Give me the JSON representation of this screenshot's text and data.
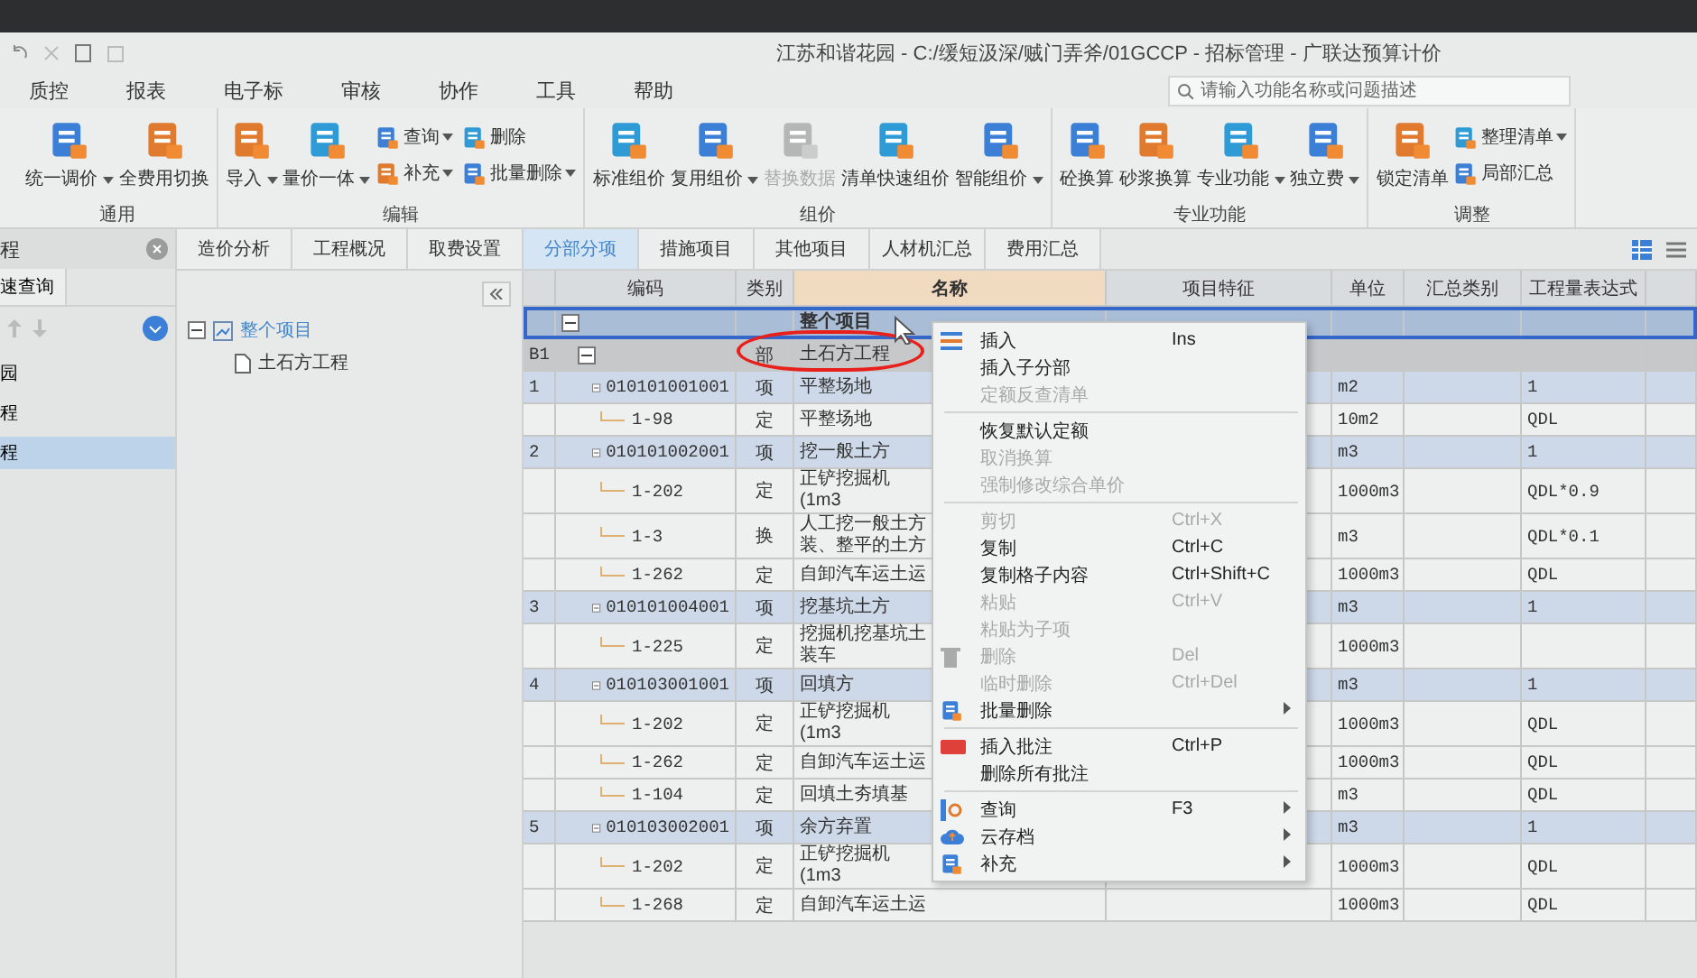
{
  "title_bar": {
    "title": "江苏和谐花园 - C:/缓短汲深/贼门弄斧/01GCCP - 招标管理 - 广联达预算计价"
  },
  "menu_bar": {
    "items": [
      "质控",
      "报表",
      "电子标",
      "审核",
      "协作",
      "工具",
      "帮助"
    ],
    "search": {
      "placeholder": "请输入功能名称或问题描述"
    }
  },
  "ribbon": {
    "groups": [
      {
        "label": "通用",
        "buttons": [
          {
            "label": "统一调价",
            "kind": "large",
            "dropdown": true,
            "disabled": false
          },
          {
            "label": "全费用切换",
            "kind": "large",
            "dropdown": false,
            "disabled": false
          }
        ]
      },
      {
        "label": "编辑",
        "buttons": [
          {
            "label": "导入",
            "kind": "large",
            "dropdown": true,
            "disabled": false
          },
          {
            "label": "量价一体",
            "kind": "large",
            "dropdown": true,
            "disabled": false
          },
          {
            "label": "查询",
            "kind": "small",
            "dropdown": true,
            "disabled": false
          },
          {
            "label": "补充",
            "kind": "small",
            "dropdown": true,
            "disabled": false
          },
          {
            "label": "删除",
            "kind": "small",
            "dropdown": false,
            "disabled": false
          },
          {
            "label": "批量删除",
            "kind": "small",
            "dropdown": true,
            "disabled": false
          }
        ]
      },
      {
        "label": "组价",
        "buttons": [
          {
            "label": "标准组价",
            "kind": "large",
            "dropdown": false,
            "disabled": false
          },
          {
            "label": "复用组价",
            "kind": "large",
            "dropdown": true,
            "disabled": false
          },
          {
            "label": "替换数据",
            "kind": "large",
            "dropdown": false,
            "disabled": true
          },
          {
            "label": "清单快速组价",
            "kind": "large",
            "dropdown": false,
            "disabled": false
          },
          {
            "label": "智能组价",
            "kind": "large",
            "dropdown": true,
            "disabled": false
          }
        ]
      },
      {
        "label": "专业功能",
        "buttons": [
          {
            "label": "砼换算",
            "kind": "large",
            "dropdown": false,
            "disabled": false
          },
          {
            "label": "砂浆换算",
            "kind": "large",
            "dropdown": false,
            "disabled": false
          },
          {
            "label": "专业功能",
            "kind": "large",
            "dropdown": true,
            "disabled": false
          },
          {
            "label": "独立费",
            "kind": "large",
            "dropdown": true,
            "disabled": false
          }
        ]
      },
      {
        "label": "调整",
        "buttons": [
          {
            "label": "锁定清单",
            "kind": "large",
            "dropdown": false,
            "disabled": false
          },
          {
            "label": "整理清单",
            "kind": "small",
            "dropdown": true,
            "disabled": false
          },
          {
            "label": "局部汇总",
            "kind": "small",
            "dropdown": false,
            "disabled": false
          }
        ]
      }
    ]
  },
  "left_panel": {
    "title": "程",
    "tab": "速查询",
    "items": [
      {
        "label": "园",
        "selected": false
      },
      {
        "label": "程",
        "selected": false
      },
      {
        "label": "程",
        "selected": true
      }
    ]
  },
  "tabs": [
    {
      "label": "造价分析",
      "selected": false
    },
    {
      "label": "工程概况",
      "selected": false
    },
    {
      "label": "取费设置",
      "selected": false
    },
    {
      "label": "分部分项",
      "selected": true
    },
    {
      "label": "措施项目",
      "selected": false
    },
    {
      "label": "其他项目",
      "selected": false
    },
    {
      "label": "人材机汇总",
      "selected": false
    },
    {
      "label": "费用汇总",
      "selected": false
    }
  ],
  "project_tree": {
    "items": [
      {
        "label": "整个项目",
        "selected": true,
        "children": [
          {
            "label": "土石方工程",
            "selected": false
          }
        ]
      }
    ]
  },
  "table": {
    "columns": [
      "编码",
      "类别",
      "名称",
      "项目特征",
      "单位",
      "汇总类别",
      "工程量表达式"
    ],
    "rows": [
      {
        "kind": "root",
        "number": "",
        "code": "",
        "type": "",
        "name": "整个项目",
        "unit": "",
        "expression": "",
        "selected": true
      },
      {
        "kind": "division",
        "number": "B1",
        "code": "",
        "type": "部",
        "name": "土石方工程",
        "unit": "",
        "expression": "",
        "selected": false
      },
      {
        "kind": "item",
        "number": "1",
        "code": "010101001001",
        "type": "项",
        "name": "平整场地",
        "unit": "m2",
        "expression": "1",
        "selected": false
      },
      {
        "kind": "quota",
        "number": "",
        "code": "1-98",
        "type": "定",
        "name": "平整场地",
        "unit": "10m2",
        "expression": "QDL",
        "selected": false
      },
      {
        "kind": "item",
        "number": "2",
        "code": "010101002001",
        "type": "项",
        "name": "挖一般土方",
        "unit": "m3",
        "expression": "1",
        "selected": false
      },
      {
        "kind": "quota",
        "number": "",
        "code": "1-202",
        "type": "定",
        "name": "正铲挖掘机(1m3",
        "unit": "1000m3",
        "expression": "QDL*0.9",
        "selected": false
      },
      {
        "kind": "quota",
        "number": "",
        "code": "1-3",
        "type": "换",
        "name": "人工挖一般土方装、整平的土方",
        "unit": "m3",
        "expression": "QDL*0.1",
        "selected": false
      },
      {
        "kind": "quota",
        "number": "",
        "code": "1-262",
        "type": "定",
        "name": "自卸汽车运土运",
        "unit": "1000m3",
        "expression": "QDL",
        "selected": false
      },
      {
        "kind": "item",
        "number": "3",
        "code": "010101004001",
        "type": "项",
        "name": "挖基坑土方",
        "unit": "m3",
        "expression": "1",
        "selected": false
      },
      {
        "kind": "quota",
        "number": "",
        "code": "1-225",
        "type": "定",
        "name": "挖掘机挖基坑土装车",
        "unit": "1000m3",
        "expression": "",
        "selected": false
      },
      {
        "kind": "item",
        "number": "4",
        "code": "010103001001",
        "type": "项",
        "name": "回填方",
        "unit": "m3",
        "expression": "1",
        "selected": false
      },
      {
        "kind": "quota",
        "number": "",
        "code": "1-202",
        "type": "定",
        "name": "正铲挖掘机(1m3",
        "unit": "1000m3",
        "expression": "QDL",
        "selected": false
      },
      {
        "kind": "quota",
        "number": "",
        "code": "1-262",
        "type": "定",
        "name": "自卸汽车运土运",
        "unit": "1000m3",
        "expression": "QDL",
        "selected": false
      },
      {
        "kind": "quota",
        "number": "",
        "code": "1-104",
        "type": "定",
        "name": "回填土夯填基",
        "unit": "m3",
        "expression": "QDL",
        "selected": false
      },
      {
        "kind": "item",
        "number": "5",
        "code": "010103002001",
        "type": "项",
        "name": "余方弃置",
        "unit": "m3",
        "expression": "1",
        "selected": false
      },
      {
        "kind": "quota",
        "number": "",
        "code": "1-202",
        "type": "定",
        "name": "正铲挖掘机(1m3",
        "unit": "1000m3",
        "expression": "QDL",
        "selected": false
      },
      {
        "kind": "quota",
        "number": "",
        "code": "1-268",
        "type": "定",
        "name": "自卸汽车运土运",
        "unit": "1000m3",
        "expression": "QDL",
        "selected": false
      }
    ]
  },
  "context_menu": {
    "items": [
      {
        "kind": "item",
        "label": "插入",
        "shortcut": "Ins",
        "disabled": false,
        "submenu": false,
        "has_icon": true
      },
      {
        "kind": "item",
        "label": "插入子分部",
        "disabled": false,
        "submenu": false,
        "has_icon": false
      },
      {
        "kind": "item",
        "label": "定额反查清单",
        "disabled": true,
        "submenu": false,
        "has_icon": false
      },
      {
        "kind": "separator"
      },
      {
        "kind": "item",
        "label": "恢复默认定额",
        "disabled": false,
        "submenu": false,
        "has_icon": false
      },
      {
        "kind": "item",
        "label": "取消换算",
        "disabled": true,
        "submenu": false,
        "has_icon": false
      },
      {
        "kind": "item",
        "label": "强制修改综合单价",
        "disabled": true,
        "submenu": false,
        "has_icon": false
      },
      {
        "kind": "separator"
      },
      {
        "kind": "item",
        "label": "剪切",
        "shortcut": "Ctrl+X",
        "disabled": true,
        "submenu": false,
        "has_icon": false
      },
      {
        "kind": "item",
        "label": "复制",
        "shortcut": "Ctrl+C",
        "disabled": false,
        "submenu": false,
        "has_icon": false
      },
      {
        "kind": "item",
        "label": "复制格子内容",
        "shortcut": "Ctrl+Shift+C",
        "disabled": false,
        "submenu": false,
        "has_icon": false
      },
      {
        "kind": "item",
        "label": "粘贴",
        "shortcut": "Ctrl+V",
        "disabled": true,
        "submenu": false,
        "has_icon": false
      },
      {
        "kind": "item",
        "label": "粘贴为子项",
        "disabled": true,
        "submenu": false,
        "has_icon": false
      },
      {
        "kind": "item",
        "label": "删除",
        "shortcut": "Del",
        "disabled": true,
        "submenu": false,
        "has_icon": true
      },
      {
        "kind": "item",
        "label": "临时删除",
        "shortcut": "Ctrl+Del",
        "disabled": true,
        "submenu": false,
        "has_icon": false
      },
      {
        "kind": "item",
        "label": "批量删除",
        "disabled": false,
        "submenu": true,
        "has_icon": true
      },
      {
        "kind": "separator"
      },
      {
        "kind": "item",
        "label": "插入批注",
        "shortcut": "Ctrl+P",
        "disabled": false,
        "submenu": false,
        "has_icon": true
      },
      {
        "kind": "item",
        "label": "删除所有批注",
        "disabled": false,
        "submenu": false,
        "has_icon": false
      },
      {
        "kind": "separator"
      },
      {
        "kind": "item",
        "label": "查询",
        "shortcut": "F3",
        "disabled": false,
        "submenu": true,
        "has_icon": true
      },
      {
        "kind": "item",
        "label": "云存档",
        "disabled": false,
        "submenu": true,
        "has_icon": true
      },
      {
        "kind": "item",
        "label": "补充",
        "disabled": false,
        "submenu": true,
        "has_icon": true
      }
    ]
  }
}
